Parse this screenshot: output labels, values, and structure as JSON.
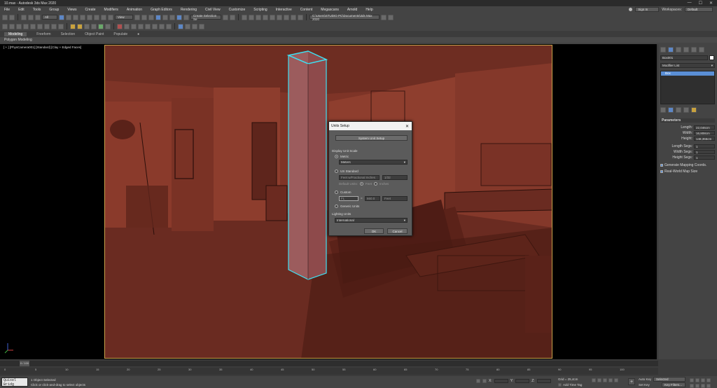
{
  "window": {
    "title": "10.max - Autodesk 3ds Max 2020",
    "min": "—",
    "max": "☐",
    "close": "✕"
  },
  "menu": [
    "File",
    "Edit",
    "Tools",
    "Group",
    "Views",
    "Create",
    "Modifiers",
    "Animation",
    "Graph Editors",
    "Rendering",
    "Civil View",
    "Customize",
    "Scripting",
    "Interactive",
    "Content",
    "Megascans",
    "Arnold",
    "Help"
  ],
  "signin": {
    "label": "Sign In",
    "workspace_label": "Workspaces:",
    "workspace_value": "Default"
  },
  "toolbar": {
    "selection_filter": "All",
    "view_dropdown": "View",
    "named_selection": "Create Selection Se",
    "path": "C:\\Users\\STUDIO PC\\Documents\\3ds Max 2020"
  },
  "ribbon": {
    "tabs": [
      "Modeling",
      "Freeform",
      "Selection",
      "Object Paint",
      "Populate"
    ],
    "active": "Modeling",
    "sub": "Polygon Modeling"
  },
  "viewport": {
    "label": "[ + ] [PhysCamera001] [Standard] [Clay + Edged Faces]"
  },
  "dialog": {
    "title": "Units Setup",
    "system_button": "System Unit Setup",
    "section": "Display Unit Scale",
    "metric_label": "Metric",
    "metric_value": "Meters",
    "us_label": "US Standard",
    "us_value": "Feet w/Fractional Inches",
    "us_frac": "1/32",
    "default_units": "Default Units:",
    "feet": "Feet",
    "inches": "Inches",
    "custom_label": "Custom",
    "custom_name": "FL",
    "custom_eq": "=",
    "custom_value": "660.0",
    "custom_unit": "Feet",
    "generic_label": "Generic Units",
    "lighting_label": "Lighting Units",
    "lighting_value": "International",
    "ok": "OK",
    "cancel": "Cancel"
  },
  "panel": {
    "object_name": "Box001",
    "modifier_list": "Modifier List",
    "stack_item": "Box",
    "rollout": "Parameters",
    "params": [
      {
        "label": "Length:",
        "value": "22,046cm"
      },
      {
        "label": "Width:",
        "value": "16,808cm"
      },
      {
        "label": "Height:",
        "value": "148,355cm"
      },
      {
        "label": "Length Segs:",
        "value": "1"
      },
      {
        "label": "Width Segs:",
        "value": "1"
      },
      {
        "label": "Height Segs:",
        "value": "1"
      }
    ],
    "checks": [
      "Generate Mapping Coords.",
      "Real-World Map Size"
    ]
  },
  "timeline": {
    "frame": "0 / 100",
    "ticks": [
      "0",
      "5",
      "10",
      "15",
      "20",
      "25",
      "30",
      "35",
      "40",
      "45",
      "50",
      "55",
      "60",
      "65",
      "70",
      "75",
      "80",
      "85",
      "90",
      "95",
      "100"
    ]
  },
  "status": {
    "script": "Quixel Bridg",
    "selected": "1 Object Selected",
    "prompt": "Click or click-and-drag to select objects",
    "x_label": "X:",
    "y_label": "Y:",
    "z_label": "Z:",
    "grid": "Grid = 25,4cm",
    "add_time_tag": "Add Time Tag",
    "auto_key": "Auto Key",
    "set_key": "Set Key",
    "selected_dd": "Selected",
    "key_filters": "Key Filters..."
  }
}
